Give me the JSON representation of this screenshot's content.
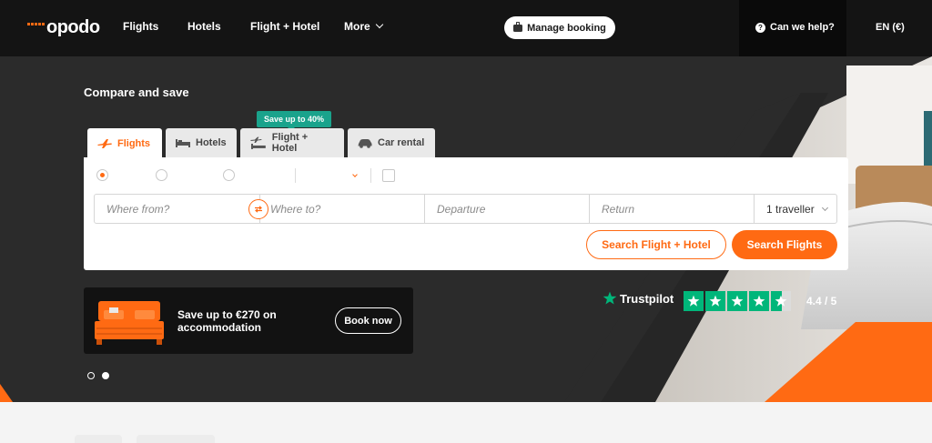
{
  "header": {
    "logo": "opodo",
    "nav": [
      {
        "label": "Flights"
      },
      {
        "label": "Hotels"
      },
      {
        "label": "Flight + Hotel"
      },
      {
        "label": "More"
      }
    ],
    "manage_booking": "Manage booking",
    "help": "Can we help?",
    "language": "EN (€)"
  },
  "hero": {
    "title": "Compare and save",
    "badge": "Save up to 40%",
    "tabs": [
      {
        "label": "Flights",
        "icon": "plane-icon",
        "active": true
      },
      {
        "label": "Hotels",
        "icon": "bed-icon",
        "active": false
      },
      {
        "label": "Flight + Hotel",
        "icon": "plane-bed-icon",
        "active": false
      },
      {
        "label": "Car rental",
        "icon": "car-icon",
        "active": false
      }
    ]
  },
  "search": {
    "from_placeholder": "Where from?",
    "to_placeholder": "Where to?",
    "departure_placeholder": "Departure",
    "return_placeholder": "Return",
    "travellers": "1 traveller",
    "btn_flight_hotel": "Search Flight + Hotel",
    "btn_flights": "Search Flights"
  },
  "promo": {
    "text": "Save up to €270 on accommodation",
    "button": "Book now"
  },
  "trustpilot": {
    "label": "Trustpilot",
    "score": "4.4 / 5",
    "rating": 4.4,
    "color": "#00b67a"
  },
  "carousel": {
    "count": 2,
    "active": 2
  },
  "colors": {
    "brand": "#ff6a13",
    "header": "#141414",
    "hero": "#2b2b2b",
    "badge": "#1aa38c"
  }
}
